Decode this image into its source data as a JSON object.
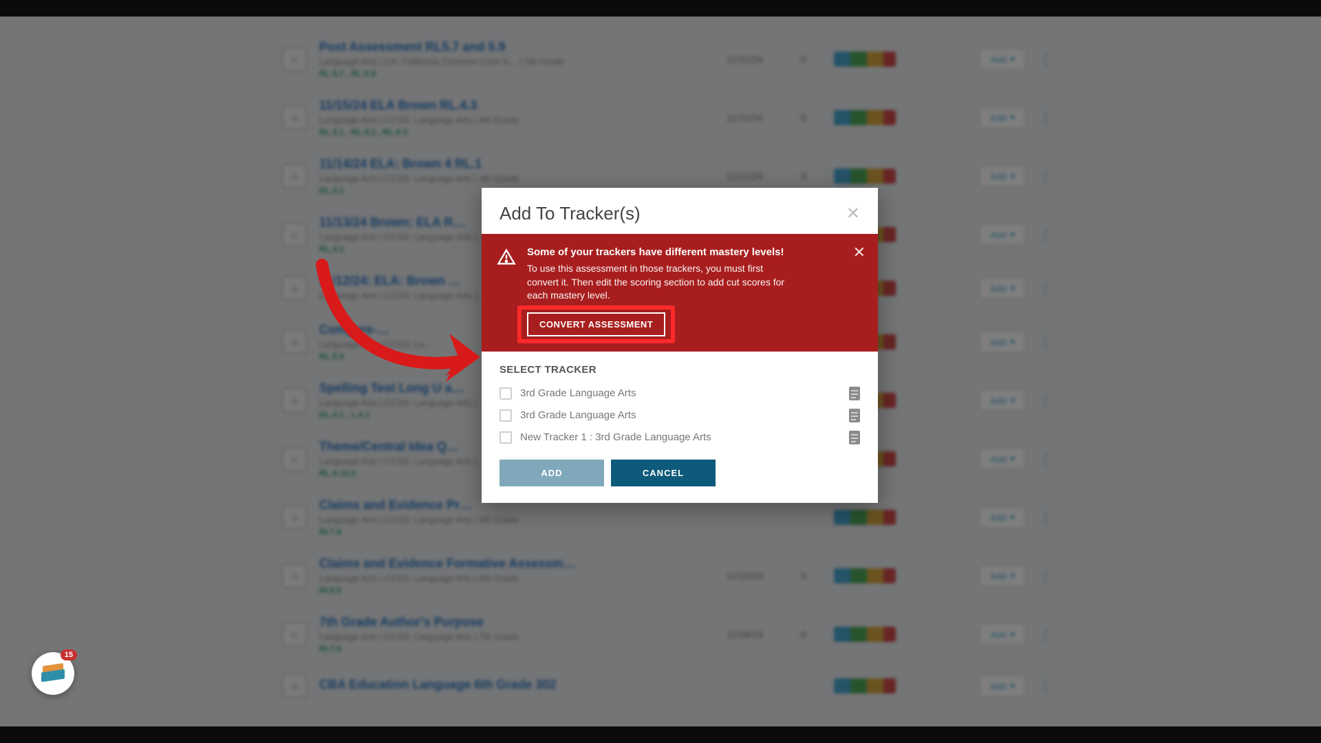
{
  "modal": {
    "title": "Add To Tracker(s)",
    "alert_title": "Some of your trackers have different mastery levels!",
    "alert_text": "To use this assessment in those trackers, you must first convert it. Then edit the scoring section to add cut scores for each mastery level.",
    "convert_label": "CONVERT ASSESSMENT",
    "select_heading": "SELECT TRACKER",
    "trackers": [
      "3rd Grade Language Arts",
      "3rd Grade Language Arts",
      "New Tracker 1 : 3rd Grade Language Arts"
    ],
    "add_label": "ADD",
    "cancel_label": "CANCEL"
  },
  "rows": [
    {
      "title": "Post Assessment RL5.7 and 5.9",
      "meta": "Language Arts  |  CA: California Common Core S…  |  5th Grade",
      "std": "RL.5.7 , RL.5.9",
      "date": "11/11/24",
      "count": "0"
    },
    {
      "title": "11/15/24 ELA Brown RL.4.3",
      "meta": "Language Arts  |  CCSS: Language Arts  |  4th Grade",
      "std": "RL.4.1 , RL.4.2 , RL.4.3",
      "date": "11/11/24",
      "count": "0"
    },
    {
      "title": "11/14/24 ELA: Brown 4 RL.1",
      "meta": "Language Arts  |  CCSS: Language Arts  |  4th Grade",
      "std": "RL.4.1",
      "date": "11/11/24",
      "count": "0"
    },
    {
      "title": "11/13/24 Brown: ELA R…",
      "meta": "Language Arts  |  CCSS: Language Arts  |  …",
      "std": "RL.4.1",
      "date": "",
      "count": ""
    },
    {
      "title": "11/12/24: ELA: Brown …",
      "meta": "Language Arts  |  CCSS: Language Arts  |  …",
      "std": "",
      "date": "",
      "count": ""
    },
    {
      "title": "Compare-…",
      "meta": "Language Arts  |  CCSS: La…",
      "std": "RL.5.9",
      "date": "",
      "count": ""
    },
    {
      "title": "Spelling Test Long U a…",
      "meta": "Language Arts  |  CCSS: Language Arts  |  …",
      "std": "RL.4.1 , L.4.1",
      "date": "",
      "count": ""
    },
    {
      "title": "Theme/Central Idea Q…",
      "meta": "Language Arts  |  CCSS: Language Arts  |  …",
      "std": "RL.6-10.2",
      "date": "",
      "count": ""
    },
    {
      "title": "Claims and Evidence Pr…",
      "meta": "Language Arts  |  CCSS: Language Arts  |  8th Grade",
      "std": "RI.7.8",
      "date": "",
      "count": ""
    },
    {
      "title": "Claims and Evidence Formative Assessm…",
      "meta": "Language Arts  |  CCSS: Language Arts  |  8th Grade",
      "std": "RI.8.8",
      "date": "11/10/24",
      "count": "0"
    },
    {
      "title": "7th Grade Author's Purpose",
      "meta": "Language Arts  |  CCSS: Language Arts  |  7th Grade",
      "std": "RI.7.6",
      "date": "11/08/24",
      "count": "0"
    },
    {
      "title": "CBA Education Language 6th Grade 302",
      "meta": "",
      "std": "",
      "date": "",
      "count": ""
    }
  ],
  "row_add_label": "Add",
  "widget_badge": "15"
}
